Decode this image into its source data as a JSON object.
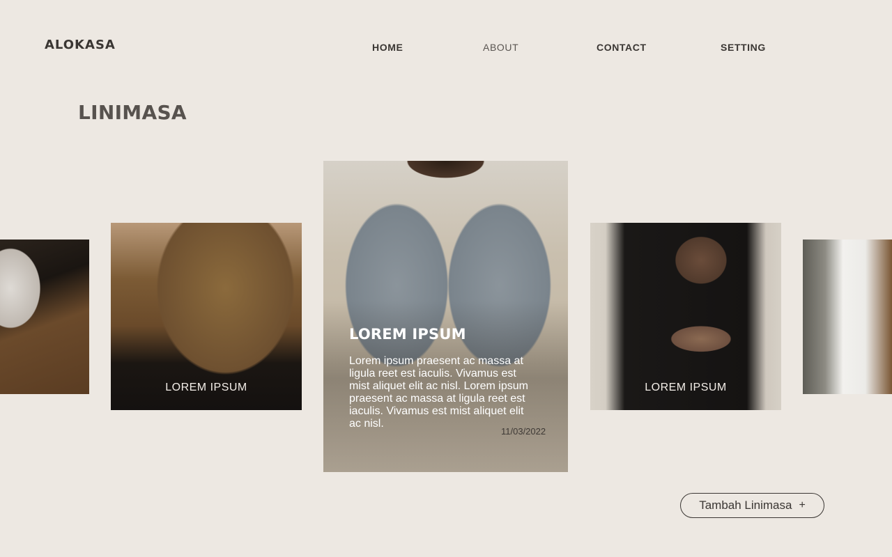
{
  "brand": "ALOKASA",
  "nav": {
    "home": "HOME",
    "about": "ABOUT",
    "contact": "CONTACT",
    "setting": "SETTING"
  },
  "page_title": "LINIMASA",
  "cards": {
    "left": {
      "label": "LOREM IPSUM"
    },
    "featured": {
      "title": "LOREM IPSUM",
      "description": "Lorem ipsum praesent ac massa at ligula reet est iaculis. Vivamus est mist aliquet elit ac nisl. Lorem ipsum praesent ac massa at ligula reet est iaculis. Vivamus est mist aliquet elit ac nisl.",
      "date": "11/03/2022"
    },
    "right": {
      "label": "LOREM IPSUM"
    }
  },
  "add_button": {
    "label": "Tambah Linimasa",
    "icon": "+"
  }
}
